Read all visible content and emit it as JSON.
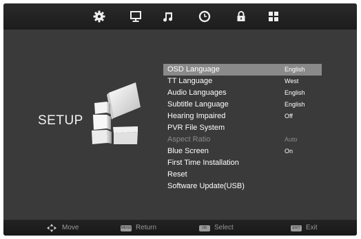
{
  "tabs": [
    {
      "icon": "gear-icon"
    },
    {
      "icon": "monitor-icon"
    },
    {
      "icon": "music-note-icon"
    },
    {
      "icon": "clock-icon"
    },
    {
      "icon": "lock-icon"
    },
    {
      "icon": "grid-icon"
    }
  ],
  "page_title": "SETUP",
  "menu": {
    "items": [
      {
        "label": "OSD Language",
        "value": "English",
        "selected": true
      },
      {
        "label": "TT Language",
        "value": "West"
      },
      {
        "label": "Audio Languages",
        "value": "English"
      },
      {
        "label": "Subtitle Language",
        "value": "English"
      },
      {
        "label": "Hearing Impaired",
        "value": "Off"
      },
      {
        "label": "PVR File System",
        "value": ""
      },
      {
        "label": "Aspect Ratio",
        "value": "Auto",
        "disabled": true
      },
      {
        "label": "Blue Screen",
        "value": "On"
      },
      {
        "label": "First Time Installation",
        "value": ""
      },
      {
        "label": "Reset",
        "value": ""
      },
      {
        "label": "Software Update(USB)",
        "value": ""
      }
    ]
  },
  "footer": {
    "move": "Move",
    "return_key": "MENU",
    "return": "Return",
    "select_key": "OK",
    "select": "Select",
    "exit_key": "EXIT",
    "exit": "Exit"
  },
  "colors": {
    "background": "#3a3a3a",
    "highlight": "#8a8a8a",
    "disabled_text": "#8c8c8c"
  }
}
